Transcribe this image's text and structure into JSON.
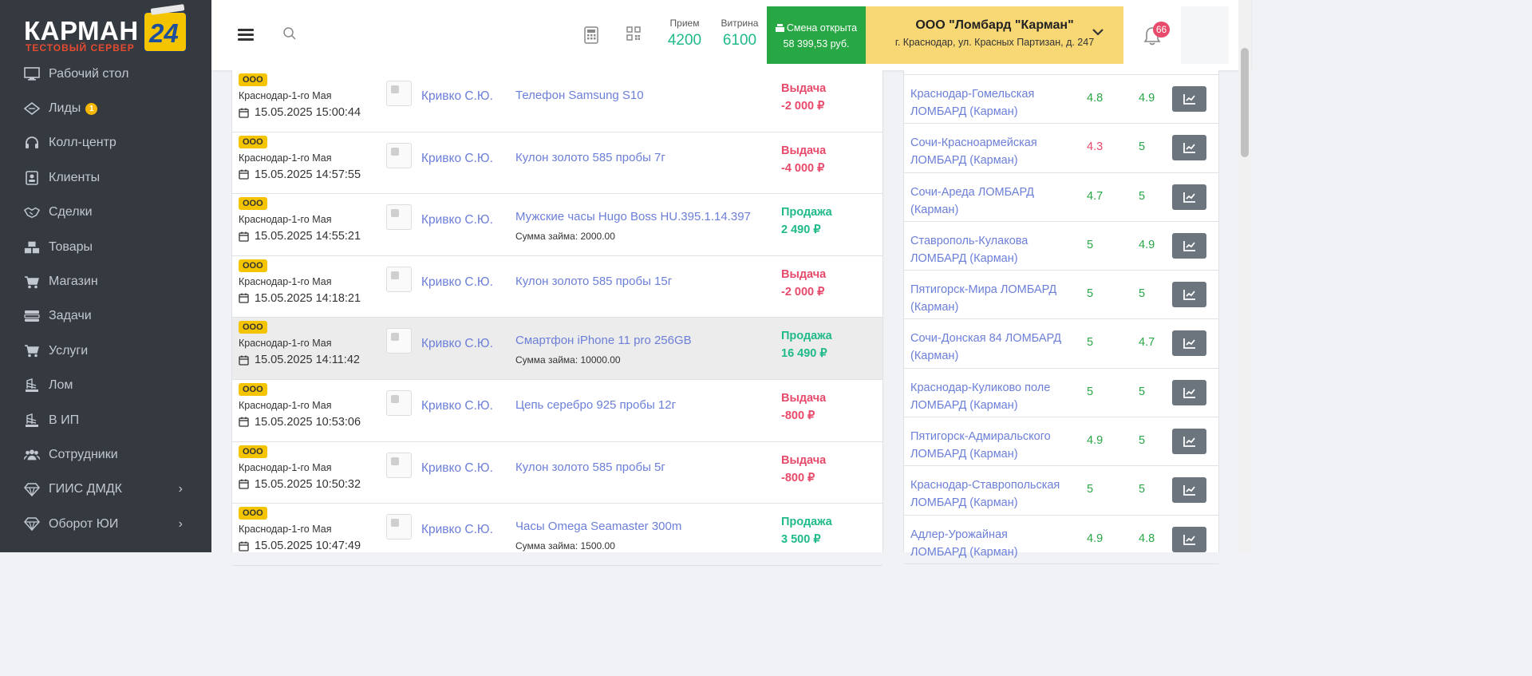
{
  "logo": {
    "main": "КАРМАН",
    "number": "24",
    "subtitle": "ТЕСТОВЫЙ СЕРВЕР"
  },
  "sidebar": {
    "items": [
      {
        "label": "Рабочий стол",
        "icon": "desktop-icon"
      },
      {
        "label": "Лиды",
        "icon": "diamond-outline-icon",
        "badge": "1"
      },
      {
        "label": "Колл-центр",
        "icon": "headset-icon"
      },
      {
        "label": "Клиенты",
        "icon": "id-card-icon"
      },
      {
        "label": "Сделки",
        "icon": "handshake-icon"
      },
      {
        "label": "Товары",
        "icon": "boxes-icon"
      },
      {
        "label": "Магазин",
        "icon": "cart-icon"
      },
      {
        "label": "Задачи",
        "icon": "tasks-icon"
      },
      {
        "label": "Услуги",
        "icon": "cart-icon"
      },
      {
        "label": "Лом",
        "icon": "scrap-icon"
      },
      {
        "label": "В ИП",
        "icon": "scrap-icon"
      },
      {
        "label": "Сотрудники",
        "icon": "users-icon"
      },
      {
        "label": "ГИИС ДМДК",
        "icon": "gem-icon",
        "expandable": true
      },
      {
        "label": "Оборот ЮИ",
        "icon": "gem-icon",
        "expandable": true
      }
    ]
  },
  "header": {
    "stats": [
      {
        "label": "Прием",
        "value": "4200"
      },
      {
        "label": "Витрина",
        "value": "6100"
      }
    ],
    "shift": {
      "title": "Смена открыта",
      "amount": "58 399,53 руб."
    },
    "company": {
      "name": "ООО \"Ломбард \"Карман\"",
      "address": "г. Краснодар, ул. Красных Партизан, д. 247"
    },
    "notifications": "66"
  },
  "transactions": [
    {
      "tag": "ООО",
      "branch": "Краснодар-1-го Мая",
      "date": "15.05.2025 15:00:44",
      "person": "Кривко С.Ю.",
      "item": "Телефон Samsung S10",
      "loan": "",
      "type": "Выдача",
      "amount": "-2 000 ₽",
      "kind": "issue"
    },
    {
      "tag": "ООО",
      "branch": "Краснодар-1-го Мая",
      "date": "15.05.2025 14:57:55",
      "person": "Кривко С.Ю.",
      "item": "Кулон золото 585 пробы 7г",
      "loan": "",
      "type": "Выдача",
      "amount": "-4 000 ₽",
      "kind": "issue"
    },
    {
      "tag": "ООО",
      "branch": "Краснодар-1-го Мая",
      "date": "15.05.2025 14:55:21",
      "person": "Кривко С.Ю.",
      "item": "Мужские часы Hugo Boss HU.395.1.14.397",
      "loan": "Сумма займа: 2000.00",
      "type": "Продажа",
      "amount": "2 490 ₽",
      "kind": "sale"
    },
    {
      "tag": "ООО",
      "branch": "Краснодар-1-го Мая",
      "date": "15.05.2025 14:18:21",
      "person": "Кривко С.Ю.",
      "item": "Кулон золото 585 пробы 15г",
      "loan": "",
      "type": "Выдача",
      "amount": "-2 000 ₽",
      "kind": "issue"
    },
    {
      "tag": "ООО",
      "branch": "Краснодар-1-го Мая",
      "date": "15.05.2025 14:11:42",
      "person": "Кривко С.Ю.",
      "item": "Смартфон iPhone 11 pro 256GB",
      "loan": "Сумма займа: 10000.00",
      "type": "Продажа",
      "amount": "16 490 ₽",
      "kind": "sale",
      "highlighted": true
    },
    {
      "tag": "ООО",
      "branch": "Краснодар-1-го Мая",
      "date": "15.05.2025 10:53:06",
      "person": "Кривко С.Ю.",
      "item": "Цепь серебро 925 пробы 12г",
      "loan": "",
      "type": "Выдача",
      "amount": "-800 ₽",
      "kind": "issue"
    },
    {
      "tag": "ООО",
      "branch": "Краснодар-1-го Мая",
      "date": "15.05.2025 10:50:32",
      "person": "Кривко С.Ю.",
      "item": "Кулон золото 585 пробы 5г",
      "loan": "",
      "type": "Выдача",
      "amount": "-800 ₽",
      "kind": "issue"
    },
    {
      "tag": "ООО",
      "branch": "Краснодар-1-го Мая",
      "date": "15.05.2025 10:47:49",
      "person": "Кривко С.Ю.",
      "item": "Часы Omega Seamaster 300m",
      "loan": "Сумма займа: 1500.00",
      "type": "Продажа",
      "amount": "3 500 ₽",
      "kind": "sale"
    }
  ],
  "branches": [
    {
      "name": "Краснодар-Гомельская ЛОМБАРД (Карман)",
      "score1": "4.8",
      "score2": "4.9",
      "c1": "green",
      "c2": "green"
    },
    {
      "name": "Сочи-Красноармейская ЛОМБАРД (Карман)",
      "score1": "4.3",
      "score2": "5",
      "c1": "red",
      "c2": "green"
    },
    {
      "name": "Сочи-Ареда ЛОМБАРД (Карман)",
      "score1": "4.7",
      "score2": "5",
      "c1": "green",
      "c2": "green"
    },
    {
      "name": "Ставрополь-Кулакова ЛОМБАРД (Карман)",
      "score1": "5",
      "score2": "4.9",
      "c1": "green",
      "c2": "green"
    },
    {
      "name": "Пятигорск-Мира ЛОМБАРД (Карман)",
      "score1": "5",
      "score2": "5",
      "c1": "green",
      "c2": "green"
    },
    {
      "name": "Сочи-Донская 84 ЛОМБАРД (Карман)",
      "score1": "5",
      "score2": "4.7",
      "c1": "green",
      "c2": "green"
    },
    {
      "name": "Краснодар-Куликово поле ЛОМБАРД (Карман)",
      "score1": "5",
      "score2": "5",
      "c1": "green",
      "c2": "green"
    },
    {
      "name": "Пятигорск-Адмиральского ЛОМБАРД (Карман)",
      "score1": "4.9",
      "score2": "5",
      "c1": "green",
      "c2": "green"
    },
    {
      "name": "Краснодар-Ставропольская ЛОМБАРД (Карман)",
      "score1": "5",
      "score2": "5",
      "c1": "green",
      "c2": "green"
    },
    {
      "name": "Адлер-Урожайная ЛОМБАРД (Карман)",
      "score1": "4.9",
      "score2": "4.8",
      "c1": "green",
      "c2": "green"
    }
  ],
  "colors": {
    "sidebar": "#343a40",
    "accent_green": "#1fb98a",
    "accent_red": "#e84a6b",
    "link": "#6c7fd8",
    "shift_bg": "#28a745",
    "company_bg": "#f8d775",
    "tag": "#f5c400"
  }
}
